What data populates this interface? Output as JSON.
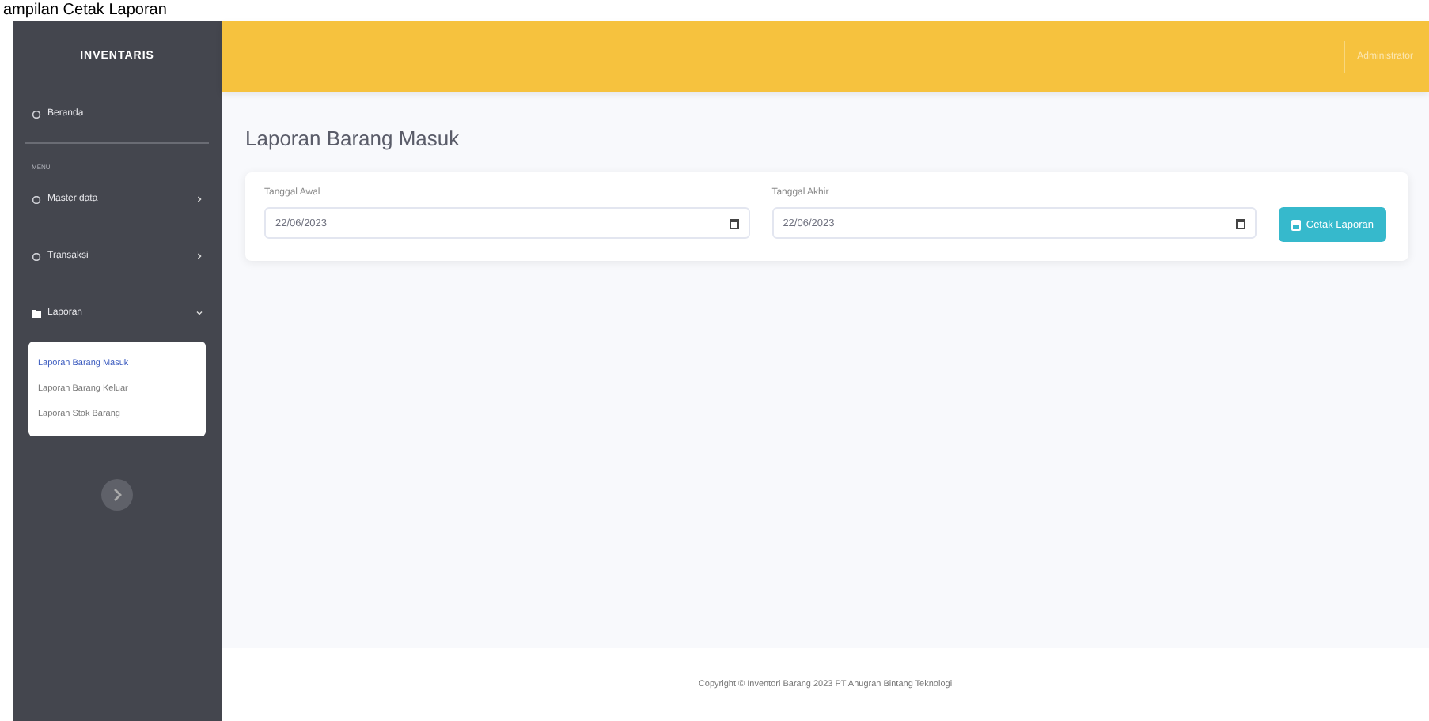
{
  "caption": "ampilan Cetak Laporan",
  "sidebar": {
    "brand": "INVENTARIS",
    "items": [
      {
        "kind": "link",
        "label": "Beranda"
      },
      {
        "kind": "heading",
        "label": "MENU"
      },
      {
        "kind": "group",
        "label": "Master data",
        "expanded": false
      },
      {
        "kind": "group",
        "label": "Transaksi",
        "expanded": false
      },
      {
        "kind": "group",
        "label": "Laporan",
        "expanded": true,
        "children": [
          {
            "label": "Laporan Barang Masuk",
            "selected": true
          },
          {
            "label": "Laporan Barang Keluar",
            "selected": false
          },
          {
            "label": "Laporan Stok Barang",
            "selected": false
          }
        ]
      }
    ]
  },
  "topbar": {
    "user": "Administrator"
  },
  "page": {
    "title": "Laporan Barang Masuk",
    "fields": [
      {
        "label": "Tanggal Awal",
        "value": "22/06/2023"
      },
      {
        "label": "Tanggal Akhir",
        "value": "22/06/2023"
      }
    ],
    "button": "Cetak Laporan"
  },
  "footer": "Copyright © Inventori Barang 2023 PT Anugrah Bintang Teknologi"
}
